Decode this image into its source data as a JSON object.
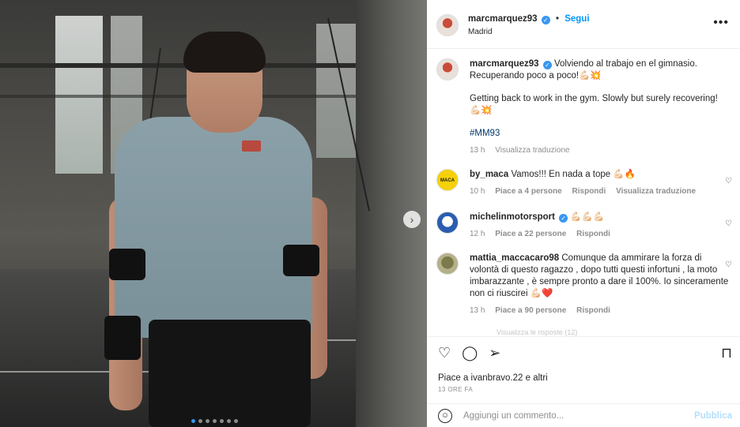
{
  "post": {
    "carousel": {
      "next_icon": "›",
      "dots": 7,
      "active_dot": 0
    },
    "header": {
      "username": "marcmarquez93",
      "separator": "•",
      "follow": "Segui",
      "location": "Madrid",
      "more": "•••"
    },
    "caption": {
      "username": "marcmarquez93",
      "text_it": "Volviendo al trabajo en el gimnasio. Recuperando poco a poco!💪🏻💥",
      "text_en": "Getting back to work in the gym. Slowly but surely recovering! 💪🏻💥",
      "hashtag": "#MM93",
      "time": "13 h",
      "translate": "Visualizza traduzione"
    },
    "comments": [
      {
        "username": "by_maca",
        "text": "Vamos!!! En nada a tope 💪🏻🔥",
        "time": "10 h",
        "likes": "Piace a 4 persone",
        "reply": "Rispondi",
        "translate": "Visualizza traduzione",
        "avatar_label": "MACA"
      },
      {
        "username": "michelinmotorsport",
        "verified": true,
        "text": "💪🏻💪🏻💪🏻",
        "time": "12 h",
        "likes": "Piace a 22 persone",
        "reply": "Rispondi"
      },
      {
        "username": "mattia_maccacaro98",
        "text": "Comunque da ammirare la forza di volontà di questo ragazzo , dopo tutti questi infortuni , la moto imbarazzante , è sempre pronto a dare il 100%. Io sinceramente non ci riuscirei 💪🏻❤️",
        "time": "13 h",
        "likes": "Piace a 90 persone",
        "reply": "Rispondi"
      }
    ],
    "partial_text": "Visualizza le risposte (12)",
    "actions": {
      "like_icon": "♡",
      "comment_icon": "◯",
      "share_icon": "➢",
      "save_icon": "⊓"
    },
    "likes_text": "Piace a ivanbravo.22 e altri",
    "date": "13 ORE FA",
    "add_comment": {
      "emoji_icon": "☺",
      "placeholder": "Aggiungi un commento...",
      "publish": "Pubblica"
    }
  },
  "colors": {
    "accent": "#0095f6",
    "verified": "#3897f0",
    "muted": "#8e8e8e"
  }
}
